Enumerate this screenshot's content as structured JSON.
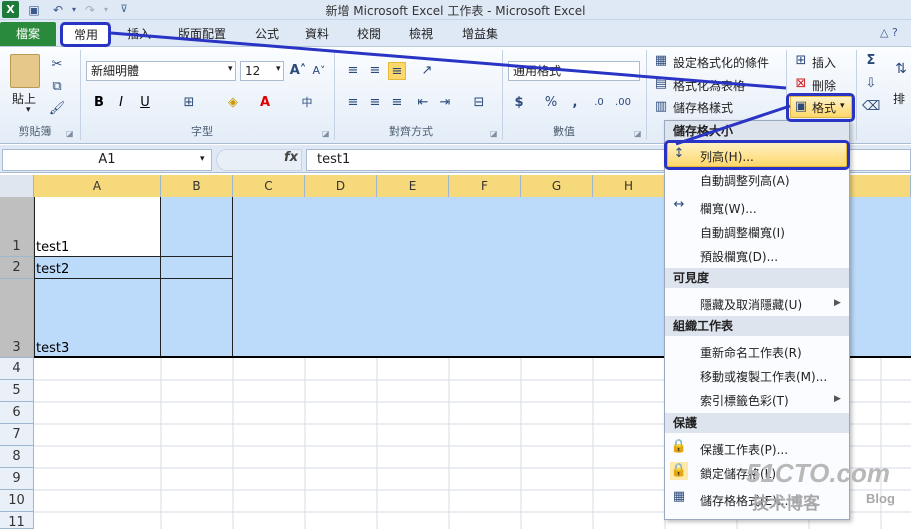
{
  "window": {
    "title": "新增 Microsoft Excel 工作表 - Microsoft Excel"
  },
  "tabs": {
    "file": "檔案",
    "home": "常用",
    "insert": "插入",
    "layout": "版面配置",
    "formulas": "公式",
    "data": "資料",
    "review": "校閱",
    "view": "檢視",
    "addins": "增益集"
  },
  "clipboard": {
    "paste": "貼上",
    "label": "剪貼簿"
  },
  "font": {
    "name": "新細明體",
    "size": "12",
    "label": "字型"
  },
  "alignment": {
    "label": "對齊方式"
  },
  "number": {
    "format": "通用格式",
    "label": "數值"
  },
  "styles": {
    "conditional": "設定格式化的條件",
    "as_table": "格式化為表格",
    "cell_styles": "儲存格樣式"
  },
  "cells": {
    "insert": "插入",
    "delete": "刪除",
    "format": "格式"
  },
  "editing": {
    "sort_partial": "排"
  },
  "formula_bar": {
    "name_box": "A1",
    "fx": "fx",
    "content": "test1"
  },
  "grid": {
    "columns": [
      "A",
      "B",
      "C",
      "D",
      "E",
      "F",
      "G",
      "H"
    ],
    "rows": [
      "1",
      "2",
      "3",
      "4",
      "5",
      "6",
      "7",
      "8",
      "9",
      "10",
      "11"
    ],
    "cells": {
      "A1": "test1",
      "A2": "test2",
      "A3": "test3"
    }
  },
  "format_menu": {
    "section_cell_size": "儲存格大小",
    "row_height": "列高(H)...",
    "autofit_row": "自動調整列高(A)",
    "column_width": "欄寬(W)...",
    "autofit_column": "自動調整欄寬(I)",
    "default_width": "預設欄寬(D)...",
    "section_visibility": "可見度",
    "hide_unhide": "隱藏及取消隱藏(U)",
    "section_organize": "組織工作表",
    "rename": "重新命名工作表(R)",
    "move_copy": "移動或複製工作表(M)...",
    "tab_color": "索引標籤色彩(T)",
    "section_protect": "保護",
    "protect_sheet": "保護工作表(P)...",
    "lock_cell": "鎖定儲存格(L)",
    "format_cells": "儲存格格式(E)..."
  },
  "watermark": {
    "site": "51CTO.com",
    "sub": "技术博客",
    "blog": "Blog"
  },
  "colors": {
    "annotation": "#2a34c4",
    "selection": "#bcdaf9",
    "file_tab": "#2a8a3c"
  }
}
